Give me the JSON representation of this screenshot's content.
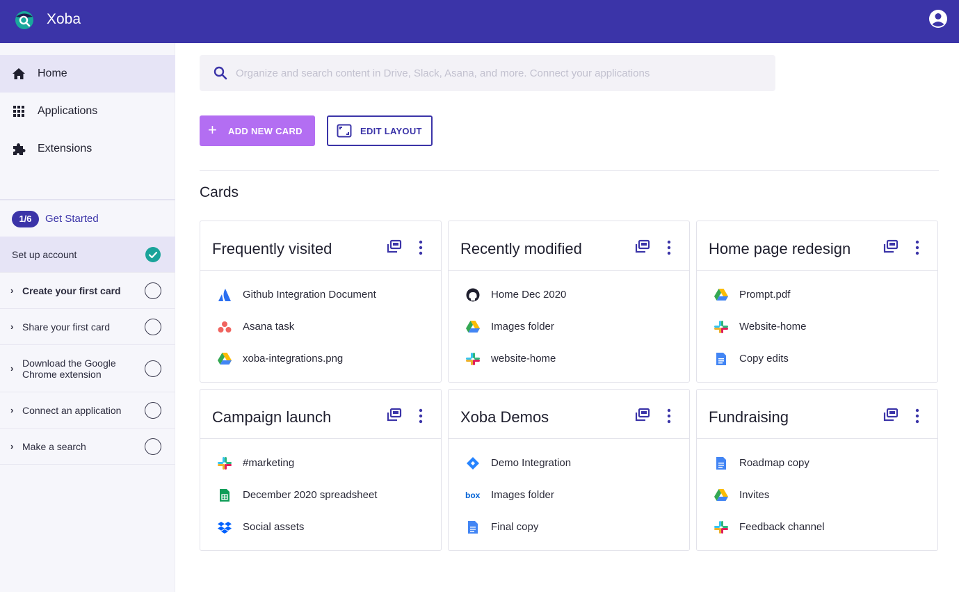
{
  "app": {
    "title": "Xoba"
  },
  "sidebar": {
    "nav": [
      {
        "label": "Home",
        "icon": "home-icon",
        "active": true
      },
      {
        "label": "Applications",
        "icon": "grid-icon",
        "active": false
      },
      {
        "label": "Extensions",
        "icon": "puzzle-icon",
        "active": false
      }
    ],
    "get_started": {
      "badge": "1/6",
      "title": "Get Started",
      "steps": [
        {
          "label": "Set up account",
          "status": "done"
        },
        {
          "label": "Create your first card",
          "status": "current"
        },
        {
          "label": "Share your first card",
          "status": "todo"
        },
        {
          "label": "Download the Google Chrome extension",
          "line1": "Download the Google",
          "line2": "Chrome extension",
          "status": "todo"
        },
        {
          "label": "Connect an application",
          "status": "todo"
        },
        {
          "label": "Make a search",
          "status": "todo"
        }
      ]
    }
  },
  "search": {
    "placeholder": "Organize and search content in Drive, Slack, Asana, and more. Connect your applications"
  },
  "toolbar": {
    "add_label": "ADD NEW CARD",
    "edit_label": "EDIT LAYOUT"
  },
  "section": {
    "title": "Cards"
  },
  "cards": [
    {
      "title": "Frequently visited",
      "items": [
        {
          "label": "Github Integration Document",
          "icon": "atlassian-icon"
        },
        {
          "label": "Asana task",
          "icon": "asana-icon"
        },
        {
          "label": "xoba-integrations.png",
          "icon": "google-drive-icon"
        }
      ]
    },
    {
      "title": "Recently modified",
      "items": [
        {
          "label": "Home Dec 2020",
          "icon": "github-icon"
        },
        {
          "label": "Images folder",
          "icon": "google-drive-icon"
        },
        {
          "label": "website-home",
          "icon": "slack-icon"
        }
      ]
    },
    {
      "title": "Home page redesign",
      "items": [
        {
          "label": "Prompt.pdf",
          "icon": "google-drive-icon"
        },
        {
          "label": "Website-home",
          "icon": "slack-icon"
        },
        {
          "label": "Copy edits",
          "icon": "google-docs-icon"
        }
      ]
    },
    {
      "title": "Campaign launch",
      "items": [
        {
          "label": "#marketing",
          "icon": "slack-icon"
        },
        {
          "label": "December 2020 spreadsheet",
          "icon": "google-sheets-icon"
        },
        {
          "label": "Social assets",
          "icon": "dropbox-icon"
        }
      ]
    },
    {
      "title": "Xoba Demos",
      "items": [
        {
          "label": "Demo Integration",
          "icon": "jira-icon"
        },
        {
          "label": "Images folder",
          "icon": "box-icon"
        },
        {
          "label": "Final copy",
          "icon": "google-docs-icon"
        }
      ]
    },
    {
      "title": "Fundraising",
      "items": [
        {
          "label": "Roadmap copy",
          "icon": "google-docs-icon"
        },
        {
          "label": "Invites",
          "icon": "google-drive-icon"
        },
        {
          "label": "Feedback channel",
          "icon": "slack-icon"
        }
      ]
    }
  ],
  "colors": {
    "primary": "#3b34a8",
    "accent": "#b36ef2",
    "success": "#1aa39a"
  }
}
